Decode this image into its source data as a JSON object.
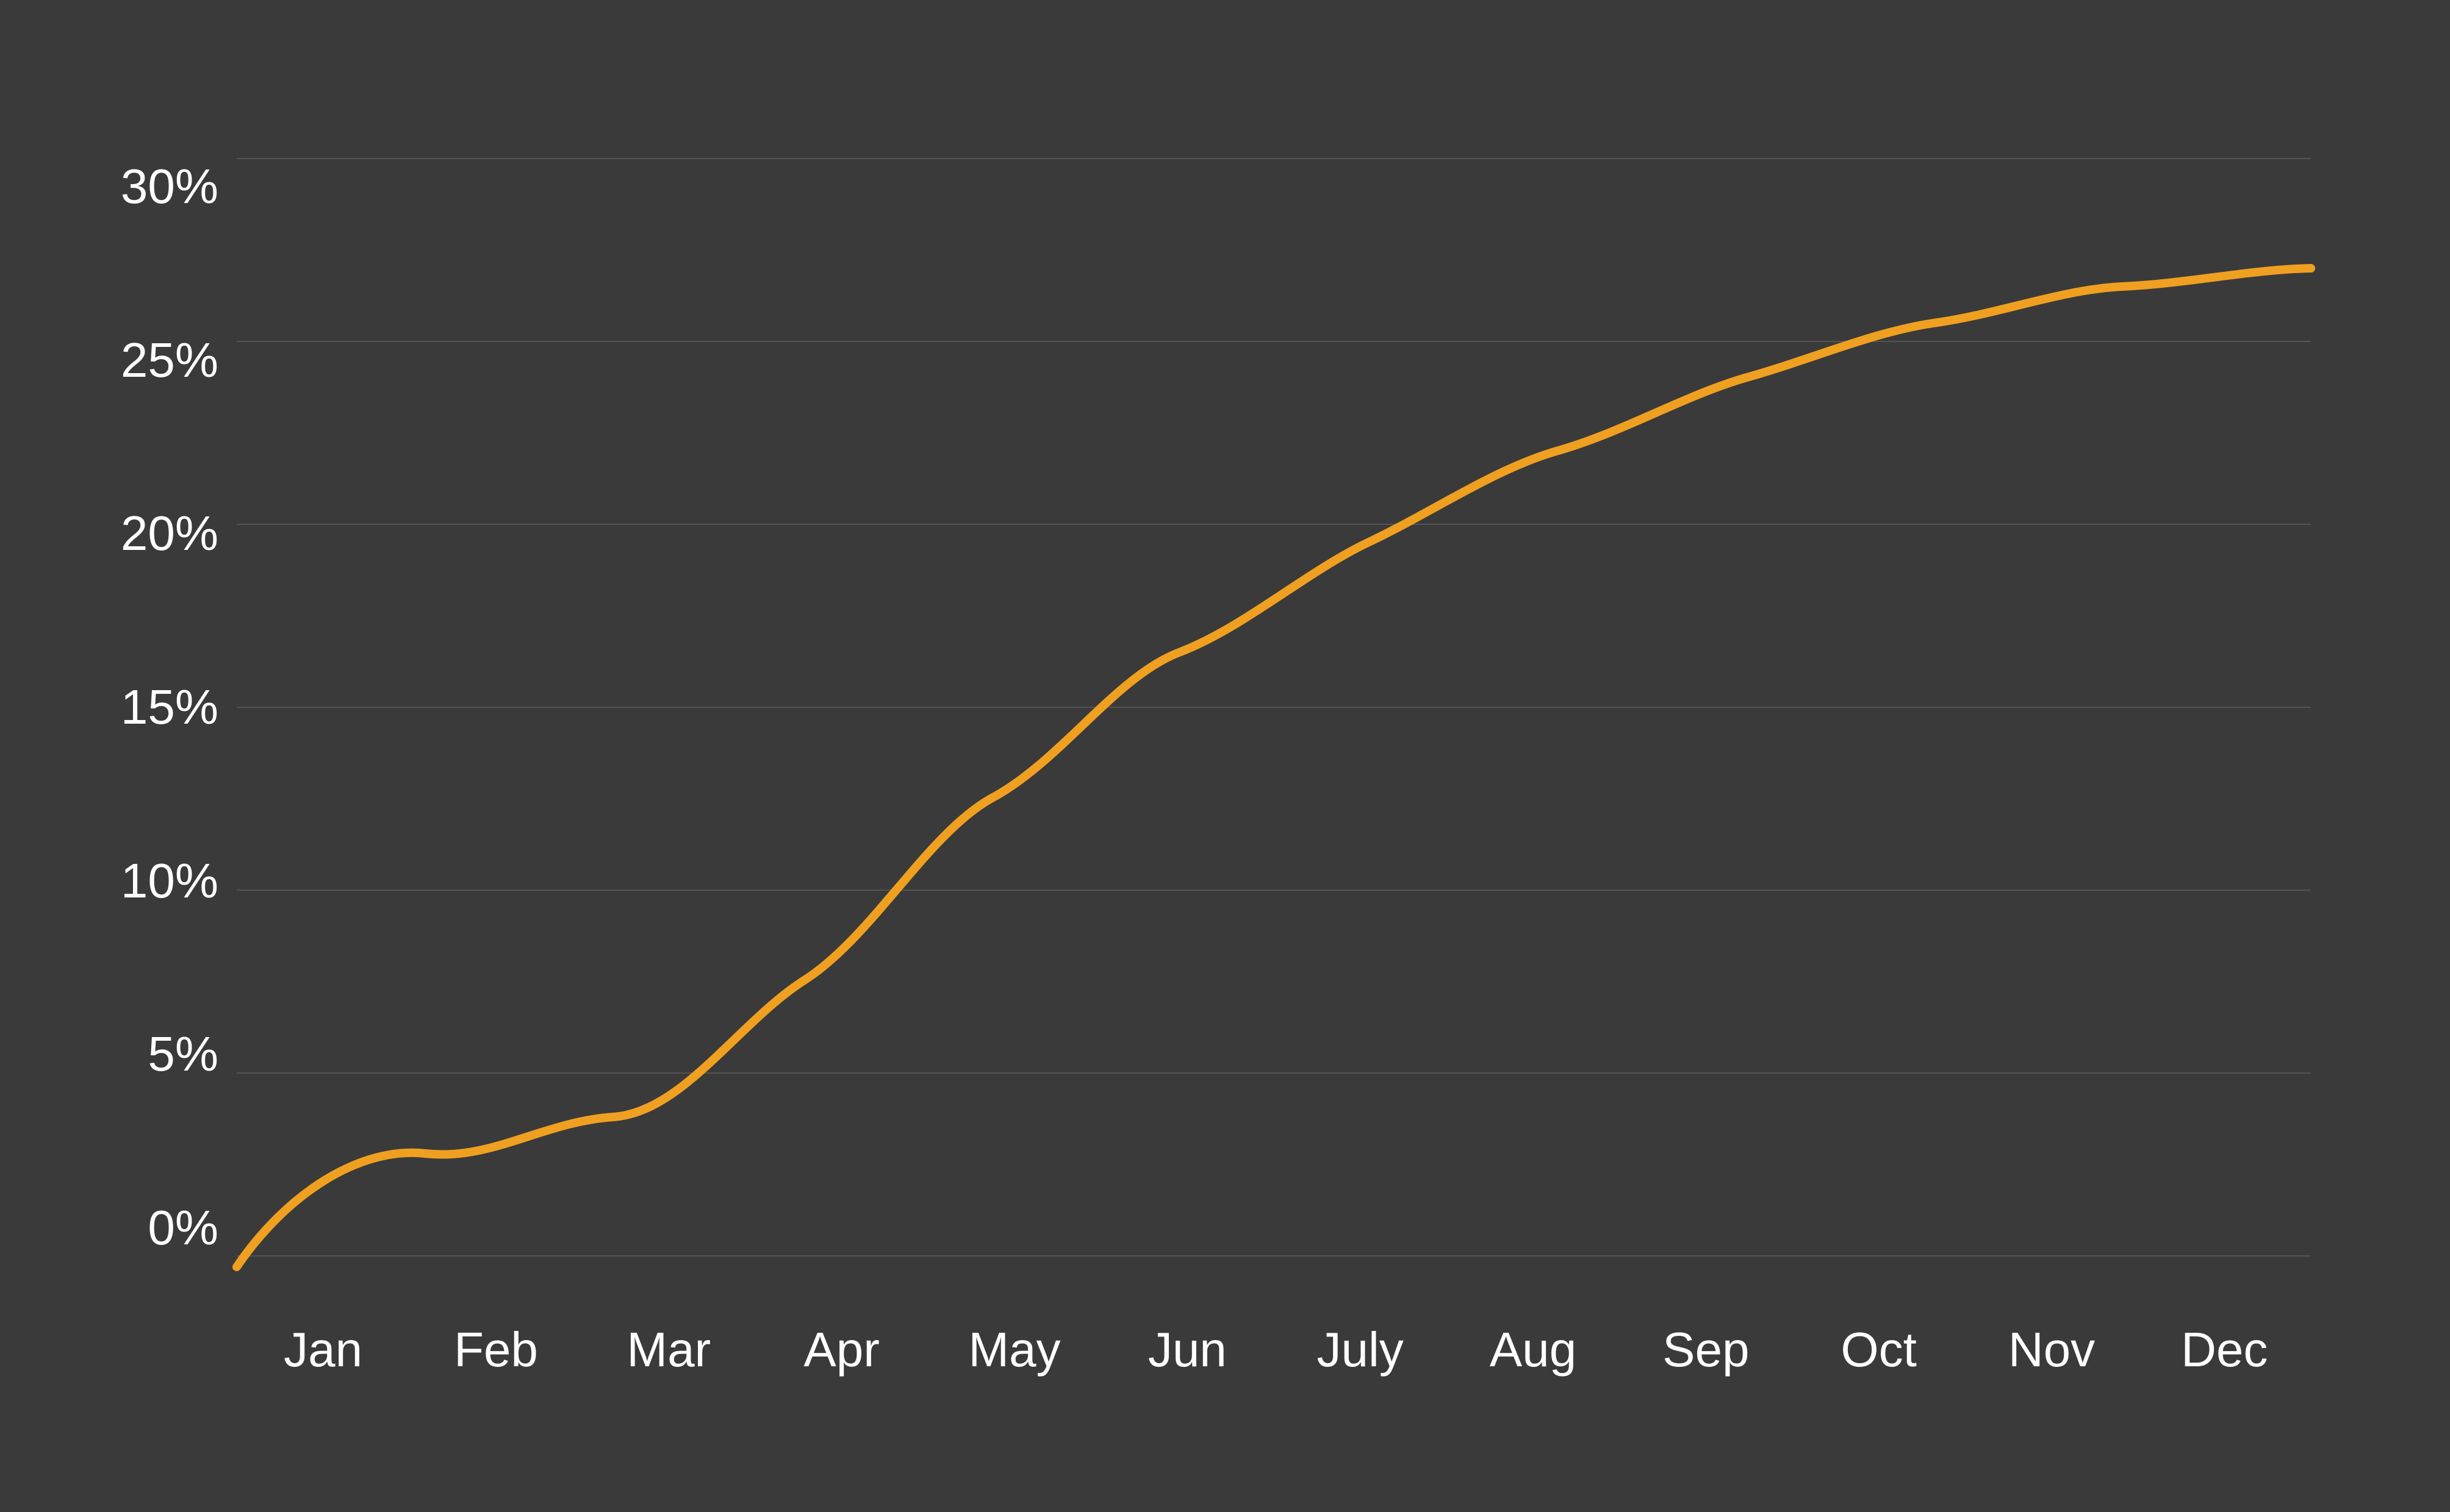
{
  "chart": {
    "background": "#3a3a3a",
    "line_color": "#f0a020",
    "y_axis": {
      "labels": [
        "30%",
        "25%",
        "20%",
        "15%",
        "10%",
        "5%",
        "0%"
      ],
      "values": [
        30,
        25,
        20,
        15,
        10,
        5,
        0
      ]
    },
    "x_axis": {
      "labels": [
        "Jan",
        "Feb",
        "Mar",
        "Apr",
        "May",
        "Jun",
        "July",
        "Aug",
        "Sep",
        "Oct",
        "Nov",
        "Dec"
      ]
    },
    "data_points": [
      {
        "month": "Jan",
        "value": -0.3
      },
      {
        "month": "Feb",
        "value": 2.8
      },
      {
        "month": "Mar",
        "value": 3.8
      },
      {
        "month": "Apr",
        "value": 7.5
      },
      {
        "month": "May",
        "value": 12.5
      },
      {
        "month": "Jun",
        "value": 16.5
      },
      {
        "month": "July",
        "value": 19.5
      },
      {
        "month": "Aug",
        "value": 22.0
      },
      {
        "month": "Sep",
        "value": 24.0
      },
      {
        "month": "Oct",
        "value": 25.5
      },
      {
        "month": "Nov",
        "value": 26.5
      },
      {
        "month": "Dec",
        "value": 27.0
      }
    ]
  }
}
